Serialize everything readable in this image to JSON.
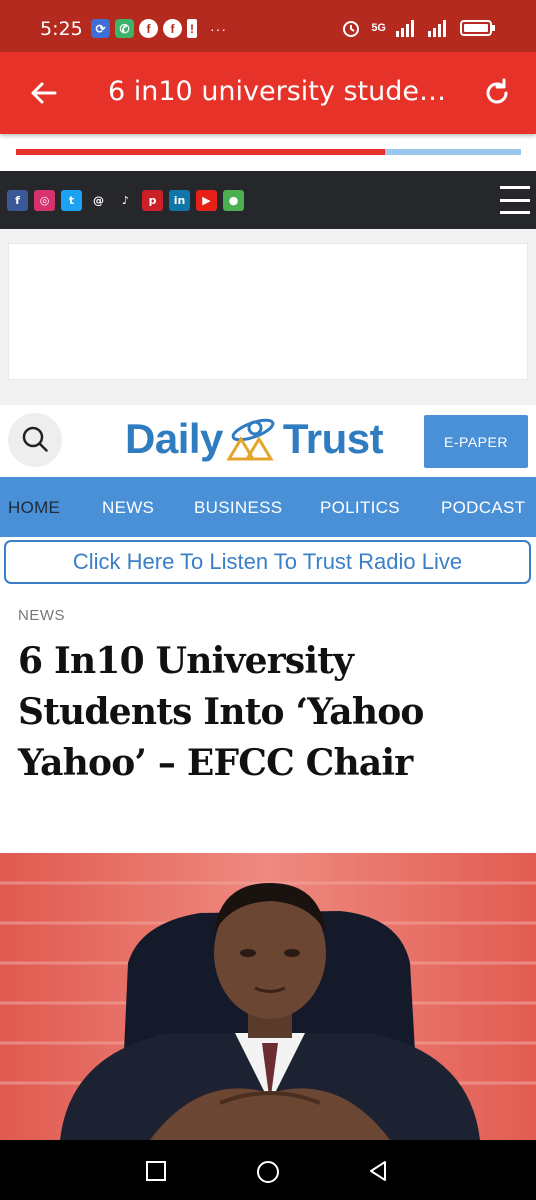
{
  "status_bar": {
    "time": "5:25",
    "network": "5G",
    "icons": [
      "sync-icon",
      "whatsapp-icon",
      "facebook-icon",
      "facebook-icon",
      "alert-icon"
    ],
    "more": "···"
  },
  "app_bar": {
    "title": "6 in10 university stude…",
    "color": "#e63228"
  },
  "load_progress": 0.73,
  "social_links": [
    {
      "icon": "facebook-icon",
      "glyph": "f",
      "color": "#3b5998"
    },
    {
      "icon": "instagram-icon",
      "glyph": "◎",
      "color": "#d6336c"
    },
    {
      "icon": "twitter-icon",
      "glyph": "t",
      "color": "#1da1f2"
    },
    {
      "icon": "threads-icon",
      "glyph": "@",
      "color": "#25272b"
    },
    {
      "icon": "tiktok-icon",
      "glyph": "♪",
      "color": "#25272b"
    },
    {
      "icon": "pinterest-icon",
      "glyph": "p",
      "color": "#cb2027"
    },
    {
      "icon": "linkedin-icon",
      "glyph": "in",
      "color": "#0e76a8"
    },
    {
      "icon": "youtube-icon",
      "glyph": "▶",
      "color": "#e62117"
    },
    {
      "icon": "location-icon",
      "glyph": "●",
      "color": "#4caf50"
    }
  ],
  "header": {
    "logo_left": "Daily",
    "logo_right": "Trust",
    "epaper": "E-PAPER"
  },
  "nav": {
    "items": [
      "HOME",
      "NEWS",
      "BUSINESS",
      "POLITICS",
      "PODCAST"
    ]
  },
  "radio_link": "Click Here To Listen To Trust Radio Live",
  "article": {
    "kicker": "NEWS",
    "headline": "6 In10 University Students Into ‘Yahoo Yahoo’ – EFCC Chair"
  },
  "colors": {
    "brand_blue": "#4a90d6",
    "status_bar": "#b42a1f"
  }
}
